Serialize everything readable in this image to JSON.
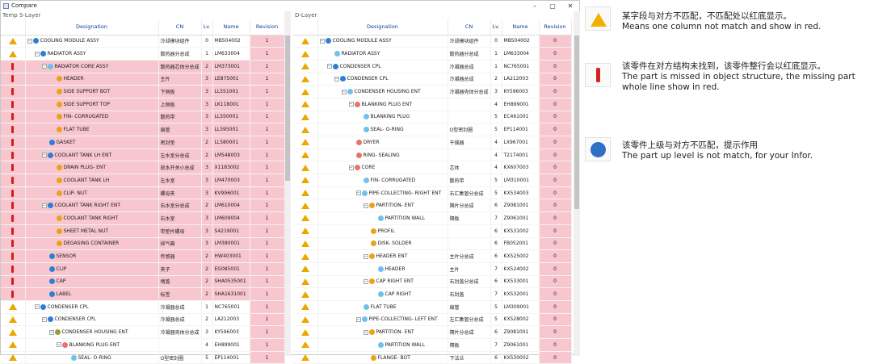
{
  "window": {
    "title": "Compare",
    "buttons": [
      "–",
      "▢",
      "✕"
    ]
  },
  "left": {
    "title": "Temp S-Layer",
    "headers": [
      "Designation",
      "CN",
      "Lv.",
      "Name",
      "Revision"
    ],
    "rows": [
      {
        "st": "warn",
        "d": 0,
        "exp": "−",
        "gear": "blue",
        "des": "COOLING MODULE ASSY",
        "cn": "冷却模块组件",
        "lv": "0",
        "name": "MB504002",
        "rev": "1",
        "red": false
      },
      {
        "st": "warn",
        "d": 1,
        "exp": "−",
        "gear": "blue",
        "des": "RADIATOR ASSY",
        "cn": "散热器分总成",
        "lv": "1",
        "name": "LM633004",
        "rev": "1",
        "red": false
      },
      {
        "st": "miss",
        "d": 2,
        "exp": "−",
        "gear": "lblue",
        "des": "RADIATOR CORE ASSY",
        "cn": "散热器芯体分总成",
        "lv": "2",
        "name": "LM373001",
        "rev": "1",
        "red": true
      },
      {
        "st": "miss",
        "d": 3,
        "exp": "",
        "gear": "gold",
        "des": "HEADER",
        "cn": "主片",
        "lv": "3",
        "name": "LE875001",
        "rev": "1",
        "red": true
      },
      {
        "st": "miss",
        "d": 3,
        "exp": "",
        "gear": "gold",
        "des": "SIDE SUPPORT BOT",
        "cn": "下侧板",
        "lv": "3",
        "name": "LL551001",
        "rev": "1",
        "red": true
      },
      {
        "st": "miss",
        "d": 3,
        "exp": "",
        "gear": "gold",
        "des": "SIDE SUPPORT TOP",
        "cn": "上侧板",
        "lv": "3",
        "name": "LK118001",
        "rev": "1",
        "red": true
      },
      {
        "st": "miss",
        "d": 3,
        "exp": "",
        "gear": "gold",
        "des": "FIN- CORRUGATED",
        "cn": "散热带",
        "lv": "3",
        "name": "LL550001",
        "rev": "1",
        "red": true
      },
      {
        "st": "miss",
        "d": 3,
        "exp": "",
        "gear": "gold",
        "des": "FLAT TUBE",
        "cn": "扁管",
        "lv": "3",
        "name": "LL595001",
        "rev": "1",
        "red": true
      },
      {
        "st": "miss",
        "d": 2,
        "exp": "",
        "gear": "blue",
        "des": "GASKET",
        "cn": "密封垫",
        "lv": "2",
        "name": "LL580001",
        "rev": "1",
        "red": true
      },
      {
        "st": "miss",
        "d": 2,
        "exp": "−",
        "gear": "blue",
        "des": "COOLANT TANK LH ENT",
        "cn": "左水室分总成",
        "lv": "2",
        "name": "LM548003",
        "rev": "1",
        "red": true
      },
      {
        "st": "miss",
        "d": 3,
        "exp": "",
        "gear": "gold",
        "des": "DRAIN PLUG- ENT",
        "cn": "放水开关小总成",
        "lv": "3",
        "name": "X1183002",
        "rev": "1",
        "red": true
      },
      {
        "st": "miss",
        "d": 3,
        "exp": "",
        "gear": "gold",
        "des": "COOLANT TANK LH",
        "cn": "左水室",
        "lv": "3",
        "name": "LM470003",
        "rev": "1",
        "red": true
      },
      {
        "st": "miss",
        "d": 3,
        "exp": "",
        "gear": "gold",
        "des": "CLIP- NUT",
        "cn": "螺母夹",
        "lv": "3",
        "name": "KV996001",
        "rev": "1",
        "red": true
      },
      {
        "st": "miss",
        "d": 2,
        "exp": "−",
        "gear": "blue",
        "des": "COOLANT TANK RIGHT ENT",
        "cn": "右水室分总成",
        "lv": "2",
        "name": "LM610004",
        "rev": "1",
        "red": true
      },
      {
        "st": "miss",
        "d": 3,
        "exp": "",
        "gear": "gold",
        "des": "COOLANT TANK RIGHT",
        "cn": "右水室",
        "lv": "3",
        "name": "LM609004",
        "rev": "1",
        "red": true
      },
      {
        "st": "miss",
        "d": 3,
        "exp": "",
        "gear": "gold",
        "des": "SHEET METAL NUT",
        "cn": "带垫片螺母",
        "lv": "3",
        "name": "S4219001",
        "rev": "1",
        "red": true
      },
      {
        "st": "miss",
        "d": 3,
        "exp": "",
        "gear": "gold",
        "des": "DEGASING CONTAINER",
        "cn": "排气箱",
        "lv": "3",
        "name": "LM380001",
        "rev": "1",
        "red": true
      },
      {
        "st": "miss",
        "d": 2,
        "exp": "",
        "gear": "blue",
        "des": "SENSOR",
        "cn": "传感器",
        "lv": "2",
        "name": "HW403001",
        "rev": "1",
        "red": true
      },
      {
        "st": "miss",
        "d": 2,
        "exp": "",
        "gear": "blue",
        "des": "CLIP",
        "cn": "夹子",
        "lv": "2",
        "name": "EG085001",
        "rev": "1",
        "red": true
      },
      {
        "st": "miss",
        "d": 2,
        "exp": "",
        "gear": "blue",
        "des": "CAP",
        "cn": "堵盖",
        "lv": "2",
        "name": "SHA0535001",
        "rev": "1",
        "red": true
      },
      {
        "st": "miss",
        "d": 2,
        "exp": "",
        "gear": "blue",
        "des": "LABEL",
        "cn": "标签",
        "lv": "2",
        "name": "SHA1631001",
        "rev": "1",
        "red": true
      },
      {
        "st": "warn",
        "d": 1,
        "exp": "−",
        "gear": "blue",
        "des": "CONDENSER CPL",
        "cn": "冷凝器总成",
        "lv": "1",
        "name": "NC765001",
        "rev": "1",
        "red": false
      },
      {
        "st": "warn",
        "d": 2,
        "exp": "−",
        "gear": "blue",
        "des": "CONDENSER CPL",
        "cn": "冷凝器总成",
        "lv": "2",
        "name": "LA212003",
        "rev": "1",
        "red": false
      },
      {
        "st": "warn",
        "d": 3,
        "exp": "−",
        "gear": "olive",
        "des": "CONDENSER HOUSING ENT",
        "cn": "冷凝器壳体分总成",
        "lv": "3",
        "name": "KY596003",
        "rev": "1",
        "red": false
      },
      {
        "st": "warn",
        "d": 4,
        "exp": "−",
        "gear": "pink",
        "des": "BLANKING PLUG ENT",
        "cn": "",
        "lv": "4",
        "name": "EH899001",
        "rev": "1",
        "red": false
      },
      {
        "st": "warn",
        "d": 5,
        "exp": "",
        "gear": "lblue",
        "des": "SEAL- O-RING",
        "cn": "O型密封圈",
        "lv": "5",
        "name": "EP114001",
        "rev": "1",
        "red": false
      }
    ]
  },
  "right": {
    "title": "D-Layer",
    "headers": [
      "Designation",
      "CN",
      "Lv.",
      "Name",
      "Revision"
    ],
    "rows": [
      {
        "st": "warn",
        "d": 0,
        "exp": "−",
        "gear": "blue",
        "des": "COOLING MODULE ASSY",
        "cn": "冷却模块组件",
        "lv": "0",
        "name": "MB504002",
        "rev": "0"
      },
      {
        "st": "warn",
        "d": 1,
        "exp": "",
        "gear": "lblue",
        "des": "RADIATOR ASSY",
        "cn": "散热器分总成",
        "lv": "1",
        "name": "LM633004",
        "rev": "0"
      },
      {
        "st": "warn",
        "d": 1,
        "exp": "−",
        "gear": "blue",
        "des": "CONDENSER CPL",
        "cn": "冷凝器总成",
        "lv": "1",
        "name": "NC765001",
        "rev": "0"
      },
      {
        "st": "warn",
        "d": 2,
        "exp": "−",
        "gear": "blue",
        "des": "CONDENSER CPL",
        "cn": "冷凝器总成",
        "lv": "2",
        "name": "LA212003",
        "rev": "0"
      },
      {
        "st": "warn",
        "d": 3,
        "exp": "−",
        "gear": "lblue",
        "des": "CONDENSER HOUSING ENT",
        "cn": "冷凝器壳体分总成",
        "lv": "3",
        "name": "KY596003",
        "rev": "0"
      },
      {
        "st": "warn",
        "d": 4,
        "exp": "−",
        "gear": "pink",
        "des": "BLANKING PLUG ENT",
        "cn": "",
        "lv": "4",
        "name": "EH899001",
        "rev": "0"
      },
      {
        "st": "warn",
        "d": 5,
        "exp": "",
        "gear": "lblue",
        "des": "BLANKING PLUG",
        "cn": "",
        "lv": "5",
        "name": "EC461001",
        "rev": "0"
      },
      {
        "st": "warn",
        "d": 5,
        "exp": "",
        "gear": "lblue",
        "des": "SEAL- O-RING",
        "cn": "O型密封圈",
        "lv": "5",
        "name": "EP114001",
        "rev": "0"
      },
      {
        "st": "warn",
        "d": 4,
        "exp": "",
        "gear": "pink",
        "des": "DRYER",
        "cn": "干燥器",
        "lv": "4",
        "name": "LX967001",
        "rev": "0"
      },
      {
        "st": "warn",
        "d": 4,
        "exp": "",
        "gear": "pink",
        "des": "RING- SEALING",
        "cn": "",
        "lv": "4",
        "name": "T2174001",
        "rev": "0"
      },
      {
        "st": "warn",
        "d": 4,
        "exp": "−",
        "gear": "pink",
        "des": "CORE",
        "cn": "芯体",
        "lv": "4",
        "name": "KX607003",
        "rev": "0"
      },
      {
        "st": "warn",
        "d": 5,
        "exp": "",
        "gear": "lblue",
        "des": "FIN- CORRUGATED",
        "cn": "散热带",
        "lv": "5",
        "name": "LM310001",
        "rev": "0"
      },
      {
        "st": "warn",
        "d": 5,
        "exp": "−",
        "gear": "lblue",
        "des": "PIPE-COLLECTING- RIGHT ENT",
        "cn": "右汇集管分总成",
        "lv": "5",
        "name": "KX534003",
        "rev": "0"
      },
      {
        "st": "warn",
        "d": 6,
        "exp": "−",
        "gear": "gold",
        "des": "PARTITION- ENT",
        "cn": "隔片分总成",
        "lv": "6",
        "name": "Z9081001",
        "rev": "0"
      },
      {
        "st": "warn",
        "d": 7,
        "exp": "",
        "gear": "lblue",
        "des": "PARTITION WALL",
        "cn": "隔板",
        "lv": "7",
        "name": "Z9061001",
        "rev": "0"
      },
      {
        "st": "warn",
        "d": 6,
        "exp": "",
        "gear": "gold",
        "des": "PROFIL",
        "cn": "",
        "lv": "6",
        "name": "KX531002",
        "rev": "0"
      },
      {
        "st": "warn",
        "d": 6,
        "exp": "",
        "gear": "gold",
        "des": "DISK- SOLDER",
        "cn": "",
        "lv": "6",
        "name": "FB052001",
        "rev": "0"
      },
      {
        "st": "warn",
        "d": 6,
        "exp": "−",
        "gear": "gold",
        "des": "HEADER ENT",
        "cn": "主片分总成",
        "lv": "6",
        "name": "KX525002",
        "rev": "0"
      },
      {
        "st": "warn",
        "d": 7,
        "exp": "",
        "gear": "lblue",
        "des": "HEADER",
        "cn": "主片",
        "lv": "7",
        "name": "KX524002",
        "rev": "0"
      },
      {
        "st": "warn",
        "d": 6,
        "exp": "−",
        "gear": "gold",
        "des": "CAP RIGHT ENT",
        "cn": "右封盖分总成",
        "lv": "6",
        "name": "KX533001",
        "rev": "0"
      },
      {
        "st": "warn",
        "d": 7,
        "exp": "",
        "gear": "lblue",
        "des": "CAP RIGHT",
        "cn": "右封盖",
        "lv": "7",
        "name": "KX532001",
        "rev": "0"
      },
      {
        "st": "warn",
        "d": 5,
        "exp": "",
        "gear": "lblue",
        "des": "FLAT TUBE",
        "cn": "扁管",
        "lv": "5",
        "name": "LM309001",
        "rev": "0"
      },
      {
        "st": "warn",
        "d": 5,
        "exp": "−",
        "gear": "lblue",
        "des": "PIPE-COLLECTING- LEFT ENT",
        "cn": "左汇集管分总成",
        "lv": "5",
        "name": "KX528002",
        "rev": "0"
      },
      {
        "st": "warn",
        "d": 6,
        "exp": "−",
        "gear": "gold",
        "des": "PARTITION- ENT",
        "cn": "隔片分总成",
        "lv": "6",
        "name": "Z9081001",
        "rev": "0"
      },
      {
        "st": "warn",
        "d": 7,
        "exp": "",
        "gear": "lblue",
        "des": "PARTITION WALL",
        "cn": "隔板",
        "lv": "7",
        "name": "Z9061001",
        "rev": "0"
      },
      {
        "st": "warn",
        "d": 6,
        "exp": "",
        "gear": "gold",
        "des": "FLANGE- BOT",
        "cn": "下法兰",
        "lv": "6",
        "name": "KX530002",
        "rev": "0"
      }
    ]
  },
  "legend": [
    {
      "icon": "warning-icon",
      "zh": "某字段与对方不匹配，不匹配处以红底显示。",
      "en": "Means one column not match and show in red."
    },
    {
      "icon": "missing-part-icon",
      "zh": "该零件在对方结构未找到，该零件整行会以红底显示。",
      "en": "The part is missed in object structure,  the missing part whole line show in red."
    },
    {
      "icon": "info-icon",
      "zh": "该零件上级与对方不匹配，提示作用",
      "en": "The part up level is not match, for your Infor."
    }
  ],
  "colors": {
    "mismatch": "#f8c6cf",
    "warning": "#e9a800",
    "missing": "#d31c1c",
    "info": "#2f74c9"
  }
}
